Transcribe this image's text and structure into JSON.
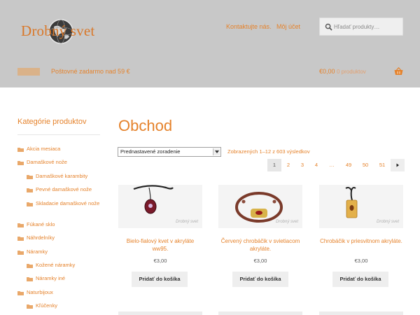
{
  "header": {
    "logo_text": "Drobný svet",
    "top_links": [
      "Kontaktujte nás.",
      "Môj účet"
    ],
    "search": {
      "placeholder": "Hľadať produkty…"
    },
    "nav": {
      "shipping": "Poštovné zadarmo nad 59 €"
    },
    "cart": {
      "total": "€0,00",
      "count": "0 produktov"
    }
  },
  "sidebar": {
    "title": "Kategórie produktov",
    "items": [
      {
        "label": "Akcia mesiaca",
        "level": 0
      },
      {
        "label": "Damaškové nože",
        "level": 0
      },
      {
        "label": "Damaškové karambity",
        "level": 1
      },
      {
        "label": "Pevné damaškové nože",
        "level": 1
      },
      {
        "label": "Skladacie damaškové nože",
        "level": 1
      },
      {
        "label": "Fúkané sklo",
        "level": 0
      },
      {
        "label": "Náhrdelníky",
        "level": 0
      },
      {
        "label": "Náramky",
        "level": 0
      },
      {
        "label": "Kožené náramky",
        "level": 1
      },
      {
        "label": "Náramky iné",
        "level": 1
      },
      {
        "label": "Naturbijoux",
        "level": 0
      },
      {
        "label": "Kľúčenky",
        "level": 1
      }
    ]
  },
  "main": {
    "title": "Obchod",
    "sort": {
      "selected": "Prednastavené zoradenie"
    },
    "result_count": "Zobrazených 1–12 z 603 výsledkov",
    "pagination": [
      "1",
      "2",
      "3",
      "4",
      "…",
      "49",
      "50",
      "51"
    ],
    "next_icon": "chevron-right-icon",
    "products": [
      {
        "name": "Bielo-fialový kvet v akryláte ww95.",
        "price": "€3,00",
        "button": "Pridať do košíka",
        "watermark": "Drobný svet"
      },
      {
        "name": "Červený chrobáčik v svietiacom akryláte.",
        "price": "€3,00",
        "button": "Pridať do košíka",
        "watermark": "Drobný svet"
      },
      {
        "name": "Chrobáčik v priesvitnom akryláte.",
        "price": "€3,00",
        "button": "Pridať do košíka",
        "watermark": "Drobný svet"
      }
    ]
  },
  "colors": {
    "accent": "#e5822b",
    "header_bg": "#c8c8c8"
  }
}
